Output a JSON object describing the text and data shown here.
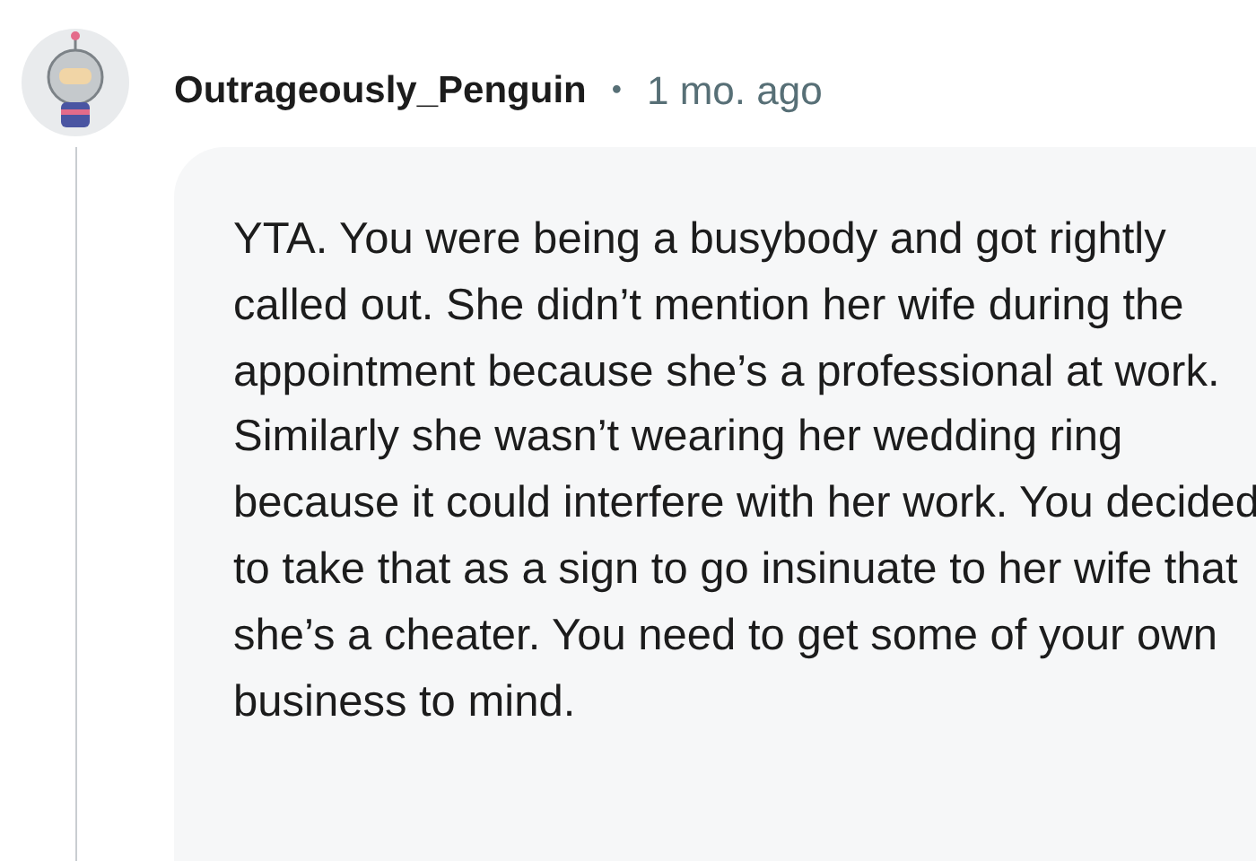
{
  "comment": {
    "author": "Outrageously_Penguin",
    "separator": "•",
    "time": "1 mo. ago",
    "body": "YTA. You were being a busybody and got rightly called out. She didn’t mention her wife during the appointment because she’s a professional at work. Similarly she wasn’t wearing her wedding ring because it could interfere with her work. You decided to take that as a sign to go insinuate to her wife that she’s a cheater. You need to get some of your own business to mind."
  }
}
